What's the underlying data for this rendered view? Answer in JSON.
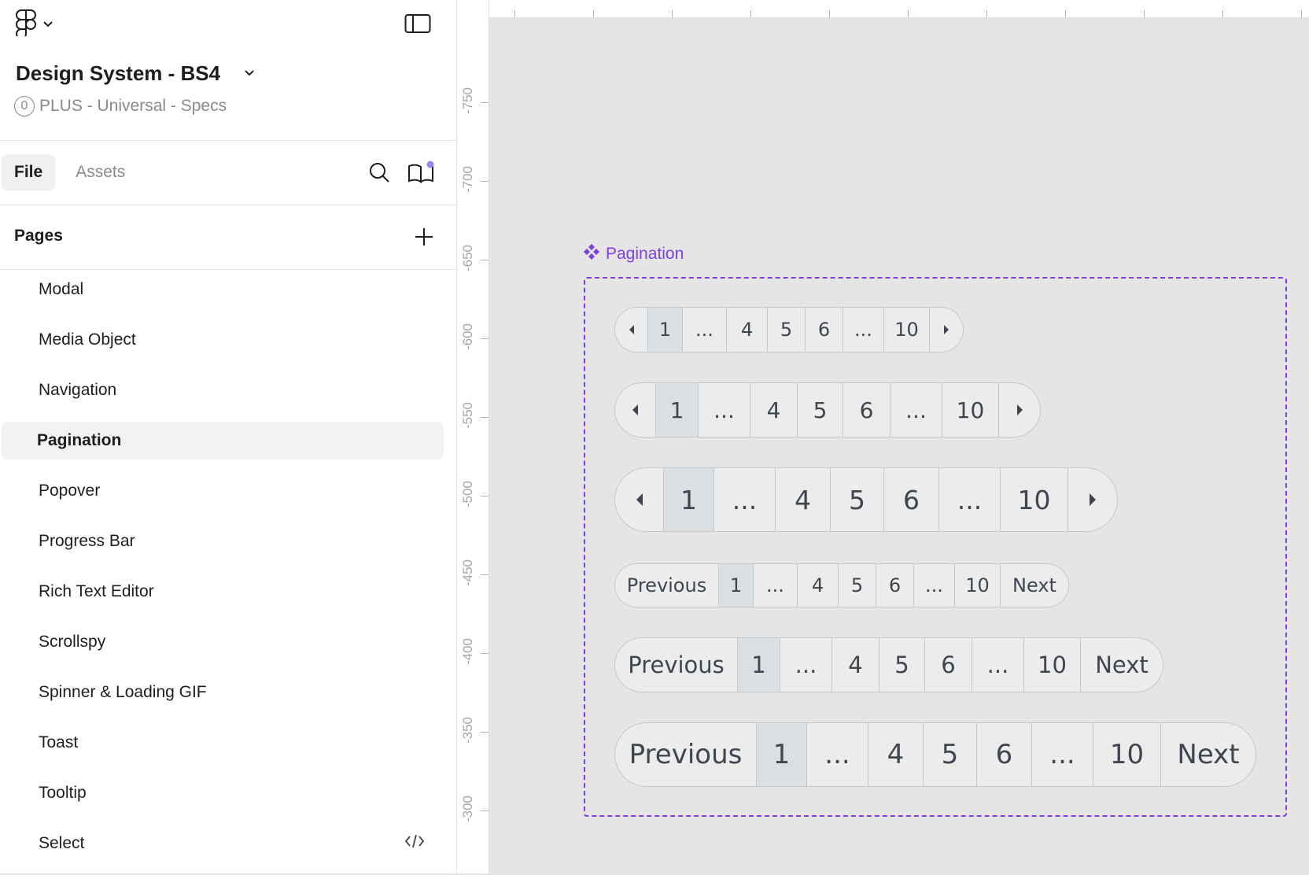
{
  "file": {
    "title": "Design System - BS4",
    "team_badge": "0",
    "subtitle": "PLUS - Universal - Specs"
  },
  "tabs": [
    {
      "label": "File",
      "active": true
    },
    {
      "label": "Assets",
      "active": false
    }
  ],
  "pages": {
    "header": "Pages",
    "items": [
      {
        "label": "Modal"
      },
      {
        "label": "Media Object"
      },
      {
        "label": "Navigation"
      },
      {
        "label": "Pagination",
        "selected": true
      },
      {
        "label": "Popover"
      },
      {
        "label": "Progress Bar"
      },
      {
        "label": "Rich Text Editor"
      },
      {
        "label": "Scrollspy"
      },
      {
        "label": "Spinner & Loading GIF"
      },
      {
        "label": "Toast"
      },
      {
        "label": "Tooltip"
      },
      {
        "label": "Select",
        "icon": "code-icon"
      }
    ]
  },
  "ruler": {
    "left_labels": [
      "-750",
      "-700",
      "-650",
      "-600",
      "-550",
      "-500",
      "-450",
      "-400",
      "-350",
      "-300"
    ]
  },
  "canvas": {
    "component_label": "Pagination",
    "accent_color": "#7b3fe4",
    "paginations": [
      {
        "prev": "arrow",
        "next": "arrow",
        "pages": [
          "1",
          "...",
          "4",
          "5",
          "6",
          "...",
          "10"
        ],
        "active": "1"
      },
      {
        "prev": "arrow",
        "next": "arrow",
        "pages": [
          "1",
          "...",
          "4",
          "5",
          "6",
          "...",
          "10"
        ],
        "active": "1"
      },
      {
        "prev": "arrow",
        "next": "arrow",
        "pages": [
          "1",
          "...",
          "4",
          "5",
          "6",
          "...",
          "10"
        ],
        "active": "1"
      },
      {
        "prev": "Previous",
        "next": "Next",
        "pages": [
          "1",
          "...",
          "4",
          "5",
          "6",
          "...",
          "10"
        ],
        "active": "1"
      },
      {
        "prev": "Previous",
        "next": "Next",
        "pages": [
          "1",
          "...",
          "4",
          "5",
          "6",
          "...",
          "10"
        ],
        "active": "1"
      },
      {
        "prev": "Previous",
        "next": "Next",
        "pages": [
          "1",
          "...",
          "4",
          "5",
          "6",
          "...",
          "10"
        ],
        "active": "1"
      }
    ]
  }
}
